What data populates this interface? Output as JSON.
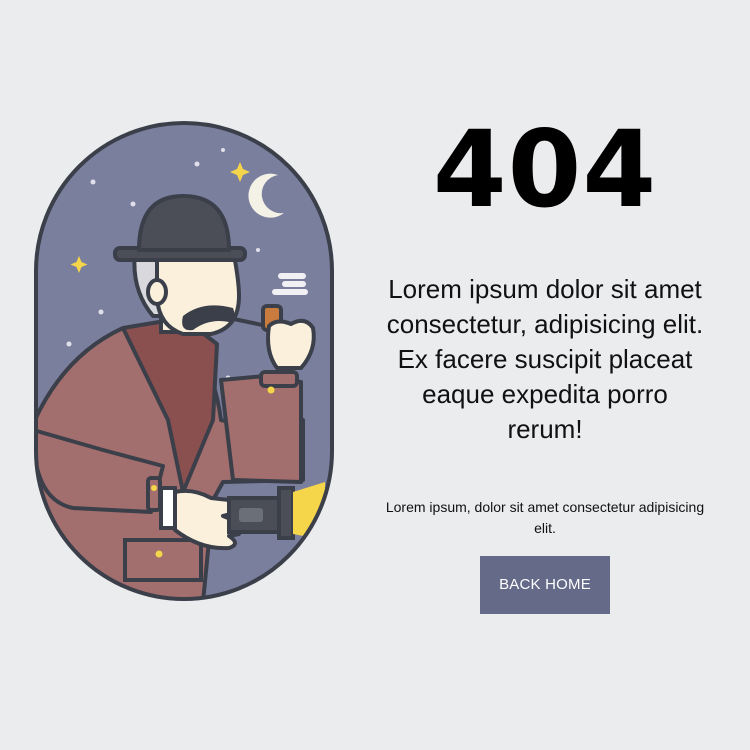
{
  "error": {
    "code": "404",
    "headline": "Lorem ipsum dolor sit amet consectetur, adipisicing elit. Ex facere suscipit placeat eaque expedita porro rerum!",
    "description": "Lorem ipsum, dolor sit amet consectetur adipisicing elit."
  },
  "actions": {
    "back_home_label": "BACK HOME"
  },
  "illustration": {
    "subject": "detective-with-pipe-and-flashlight",
    "colors": {
      "background": "#ebecee",
      "sky": "#7b7f9e",
      "coat": "#a26e6e",
      "collar": "#8a4f4f",
      "hat": "#4b4e57",
      "accent": "#f5d54a",
      "button": "#646a88"
    }
  }
}
